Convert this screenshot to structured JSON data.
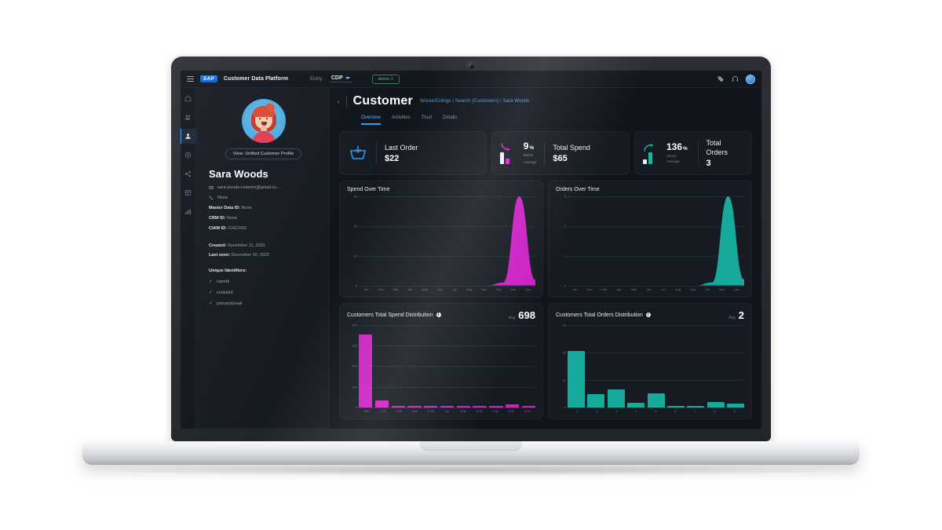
{
  "topbar": {
    "menu_icon": "hamburger-icon",
    "brand": "SAP",
    "app_title": "Customer Data Platform",
    "entity_label": "Entity:",
    "entity_value": "CDP",
    "badge": "demo 1",
    "right_icons": [
      "tag-icon",
      "headset-icon",
      "user-avatar"
    ]
  },
  "rail": {
    "items": [
      {
        "name": "home-icon",
        "active": false
      },
      {
        "name": "audiences-icon",
        "active": false
      },
      {
        "name": "customers-icon",
        "active": true
      },
      {
        "name": "activities-icon",
        "active": false
      },
      {
        "name": "connections-icon",
        "active": false
      },
      {
        "name": "applications-icon",
        "active": false
      },
      {
        "name": "analytics-icon",
        "active": false
      }
    ]
  },
  "header": {
    "back": "‹",
    "title": "Customer",
    "breadcrumb": "WouterEntrigo / Search (Customers) / Sara Woods"
  },
  "tabs": [
    {
      "label": "Overview",
      "active": true
    },
    {
      "label": "Activities",
      "active": false
    },
    {
      "label": "Trust",
      "active": false
    },
    {
      "label": "Details",
      "active": false
    }
  ],
  "profile": {
    "view_button": "View: Unified Customer Profile",
    "name": "Sara Woods",
    "email": "sara.woods-cxdemo@gmail.co...",
    "phone": "None",
    "ids": [
      {
        "label": "Master Data ID:",
        "value": "None"
      },
      {
        "label": "CRM ID:",
        "value": "None"
      },
      {
        "label": "CIAM ID:",
        "value": "CI412420"
      }
    ],
    "created_label": "Created:",
    "created_value": "November 11, 2022",
    "last_seen_label": "Last seen:",
    "last_seen_value": "December 20, 2022",
    "unique_identifiers_title": "Unique Identifiers:",
    "unique_identifiers": [
      "ciamId",
      "cookieId",
      "primaryEmail"
    ]
  },
  "kpis": [
    {
      "icon": "basket-icon",
      "label": "Last Order",
      "value": "$22"
    },
    {
      "icon": "arrow-down-icon",
      "percent": "9",
      "percent_symbol": "%",
      "sub_line1": "Below",
      "sub_line2": "Average",
      "label": "Total Spend",
      "value": "$65",
      "color": "#d925c8"
    },
    {
      "icon": "arrow-up-icon",
      "percent": "136",
      "percent_symbol": "%",
      "sub_line1": "Above Average",
      "label": "Total Orders",
      "value": "3",
      "color": "#1ab5a0"
    }
  ],
  "colors": {
    "magenta": "#cc22c4",
    "teal": "#17a999",
    "blue": "#2f8ee0",
    "card_bg": "#161b23",
    "page_bg": "#10151c",
    "grid": "#242c38"
  },
  "chart_data": [
    {
      "type": "area",
      "title": "Spend Over Time",
      "categories": [
        "Jan",
        "Feb",
        "Mar",
        "Apr",
        "May",
        "Jun",
        "Jul",
        "Aug",
        "Sep",
        "Oct",
        "Nov",
        "Dec"
      ],
      "values": [
        0,
        0,
        0,
        0,
        0,
        0,
        0,
        0,
        0,
        2,
        65,
        4
      ],
      "yticks": [
        "65",
        "44",
        "22",
        "0"
      ],
      "ylim": [
        0,
        65
      ],
      "color": "#cc22c4",
      "xlabel": "",
      "ylabel": "",
      "grid": true
    },
    {
      "type": "area",
      "title": "Orders Over Time",
      "categories": [
        "Jan",
        "Feb",
        "Mar",
        "Apr",
        "May",
        "Jun",
        "Jul",
        "Aug",
        "Sep",
        "Oct",
        "Nov",
        "Dec"
      ],
      "values": [
        0,
        0,
        0,
        0,
        0,
        0,
        0,
        0,
        0,
        0.1,
        3,
        0.2
      ],
      "yticks": [
        "3",
        "2",
        "1",
        "0"
      ],
      "ylim": [
        0,
        3
      ],
      "color": "#17a999",
      "xlabel": "",
      "ylabel": "",
      "grid": true
    },
    {
      "type": "bar",
      "title": "Customers Total Spend Distribution",
      "info_icon": "info-icon",
      "avg_label": "Avg",
      "avg_value": "698",
      "categories": [
        "950",
        "1.7k",
        "2.5k",
        "3.4k",
        "4.2k",
        "5k",
        "5.9k",
        "6.7k",
        "7.6k",
        "8.4k",
        "9.2k"
      ],
      "values": [
        390,
        38,
        4,
        10,
        4,
        3,
        3,
        3,
        3,
        16,
        4
      ],
      "yticks": [
        "400",
        "300",
        "200",
        "100",
        "0"
      ],
      "ylim": [
        0,
        440
      ],
      "color": "#cc22c4",
      "grid": true
    },
    {
      "type": "bar",
      "title": "Customers Total Orders Distribution",
      "info_icon": "info-icon",
      "avg_label": "Avg",
      "avg_value": "2",
      "categories": [
        "1",
        "2",
        "3",
        "4",
        "5",
        "6",
        "7",
        "8",
        "9"
      ],
      "values": [
        205,
        48,
        65,
        16,
        52,
        3,
        3,
        20,
        14
      ],
      "yticks": [
        "30",
        "20",
        "10",
        "0"
      ],
      "ylim": [
        0,
        300
      ],
      "color": "#17a999",
      "grid": true
    }
  ]
}
